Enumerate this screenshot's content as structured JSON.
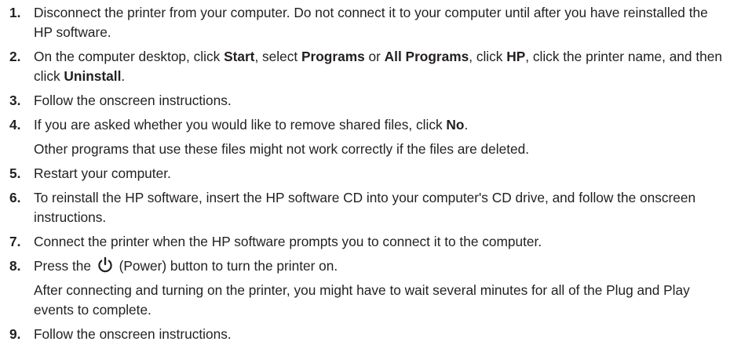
{
  "steps": [
    {
      "num": "1.",
      "text": "Disconnect the printer from your computer. Do not connect it to your computer until after you have reinstalled the HP software."
    },
    {
      "num": "2.",
      "parts": [
        "On the computer desktop, click ",
        "Start",
        ", select ",
        "Programs",
        " or ",
        "All Programs",
        ", click ",
        "HP",
        ", click the printer name, and then click ",
        "Uninstall",
        "."
      ]
    },
    {
      "num": "3.",
      "text": "Follow the onscreen instructions."
    },
    {
      "num": "4.",
      "parts": [
        "If you are asked whether you would like to remove shared files, click ",
        "No",
        "."
      ],
      "note": "Other programs that use these files might not work correctly if the files are deleted."
    },
    {
      "num": "5.",
      "text": "Restart your computer."
    },
    {
      "num": "6.",
      "text": "To reinstall the HP software, insert the HP software CD into your computer's CD drive, and follow the onscreen instructions."
    },
    {
      "num": "7.",
      "text": "Connect the printer when the HP software prompts you to connect it to the computer."
    },
    {
      "num": "8.",
      "parts": [
        "Press the ",
        " (Power) button to turn the printer on."
      ],
      "icon": "power-icon",
      "note": "After connecting and turning on the printer, you might have to wait several minutes for all of the Plug and Play events to complete."
    },
    {
      "num": "9.",
      "text": "Follow the onscreen instructions."
    }
  ]
}
